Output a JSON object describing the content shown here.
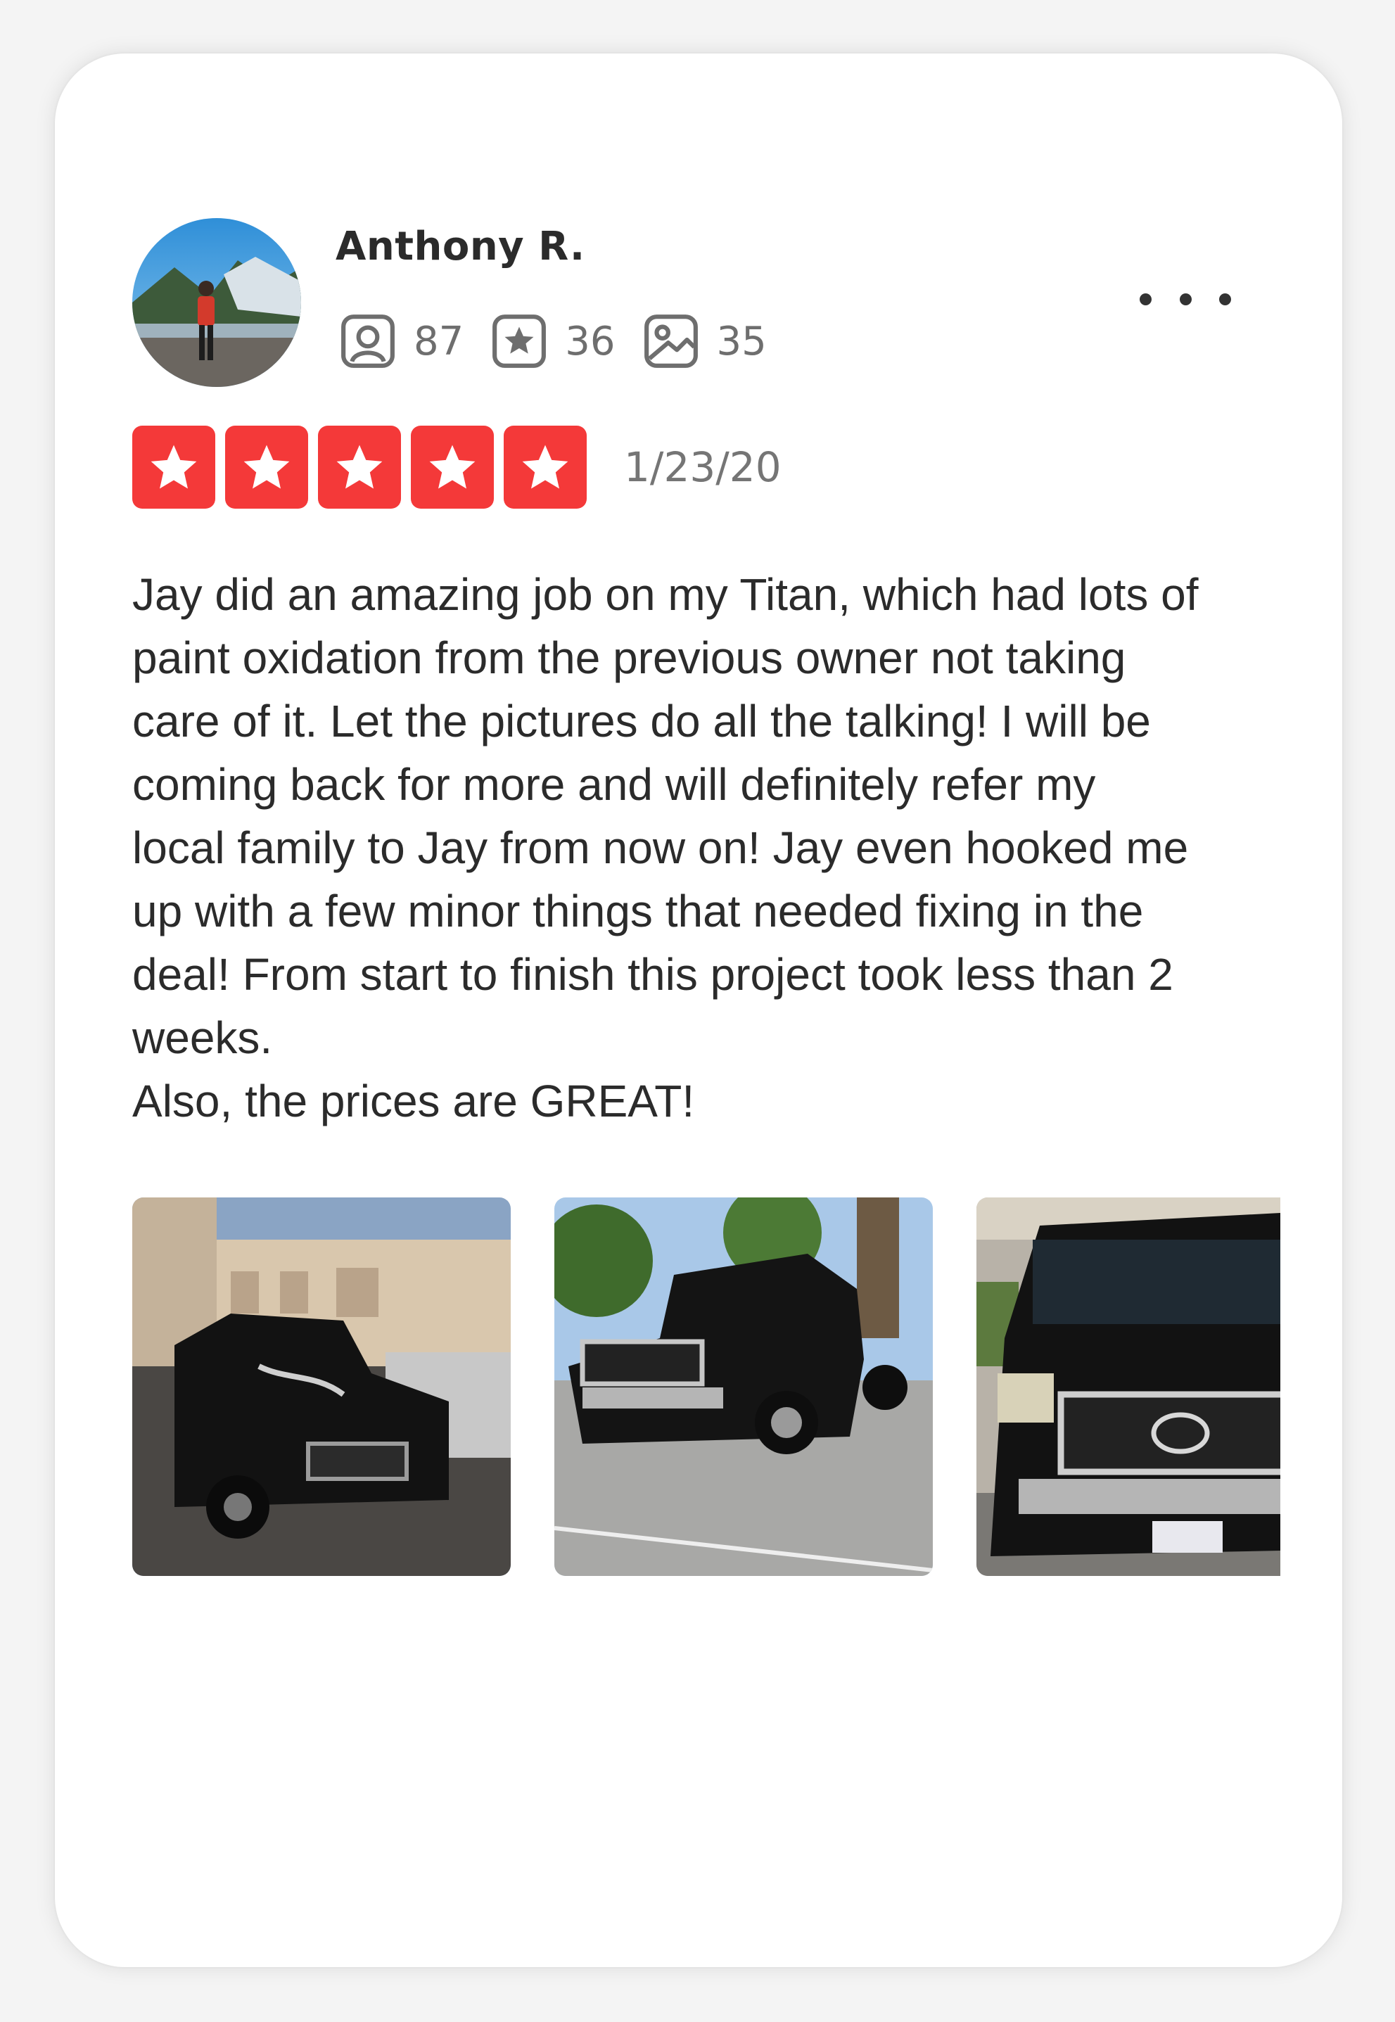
{
  "user": {
    "name": "Anthony R.",
    "stats": {
      "friends": "87",
      "reviews": "36",
      "photos": "35"
    }
  },
  "review": {
    "rating": 5,
    "date": "1/23/20",
    "text": "Jay did an amazing job on my Titan, which had lots of\npaint oxidation from the previous owner not taking\ncare of it. Let the pictures do all the talking! I will be\ncoming back for more and will definitely refer my\nlocal family to Jay from now on! Jay even hooked me\nup with a few minor things that needed fixing in the\ndeal! From start to finish this project took less than 2\nweeks.\nAlso, the prices are GREAT!"
  },
  "colors": {
    "star_red": "#f43939",
    "text_dark": "#2b2b2b",
    "text_gray": "#757575"
  }
}
